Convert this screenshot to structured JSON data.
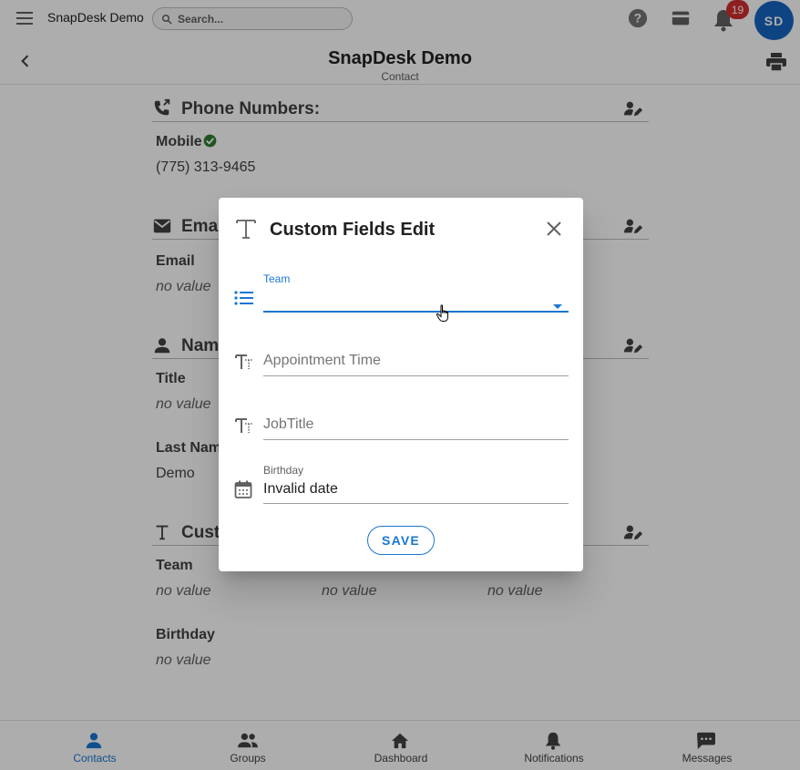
{
  "app": {
    "title": "SnapDesk Demo",
    "search_placeholder": "Search...",
    "notification_count": "19",
    "avatar_initials": "SD"
  },
  "header": {
    "title": "SnapDesk Demo",
    "subtitle": "Contact"
  },
  "sections": {
    "phone": {
      "title": "Phone Numbers:",
      "label": "Mobile",
      "value": "(775) 313-9465"
    },
    "email": {
      "title": "Ema",
      "label": "Email",
      "value": "no value"
    },
    "name": {
      "title": "Nam",
      "title_label": "Title",
      "title_value": "no value",
      "last_name_label": "Last Nam",
      "last_name_value": "Demo"
    },
    "custom": {
      "title": "Cust",
      "team_label": "Team",
      "team_value": "no value",
      "col2_value": "no value",
      "col3_value": "no value",
      "birthday_label": "Birthday",
      "birthday_value": "no value"
    }
  },
  "dialog": {
    "title": "Custom Fields Edit",
    "fields": {
      "team_label": "Team",
      "team_value": "",
      "appointment_placeholder": "Appointment Time",
      "jobtitle_placeholder": "JobTitle",
      "birthday_label": "Birthday",
      "birthday_value": "Invalid date"
    },
    "save_label": "SAVE"
  },
  "bottom_nav": {
    "items": [
      {
        "label": "Contacts",
        "icon": "person-icon"
      },
      {
        "label": "Groups",
        "icon": "groups-icon"
      },
      {
        "label": "Dashboard",
        "icon": "home-icon"
      },
      {
        "label": "Notifications",
        "icon": "bell-icon"
      },
      {
        "label": "Messages",
        "icon": "message-icon"
      }
    ]
  },
  "colors": {
    "primary": "#1976d2",
    "badge": "#d32f2f",
    "avatar": "#1565c0",
    "verified": "#2e7d32"
  }
}
